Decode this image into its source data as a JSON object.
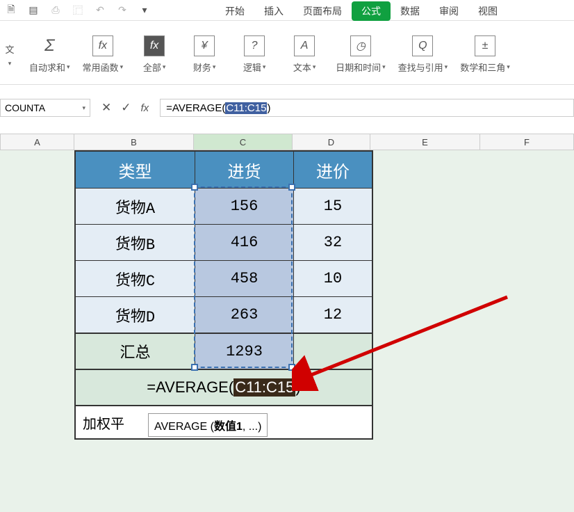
{
  "qab_icons": [
    "save",
    "print",
    "undo",
    "redo",
    "copy",
    "sep",
    "touch"
  ],
  "menu": {
    "start": "开始",
    "insert": "插入",
    "layout": "页面布局",
    "formula": "公式",
    "data": "数据",
    "review": "审阅",
    "view": "视图"
  },
  "ribbon": {
    "sum": {
      "icon": "Σ",
      "label": "自动求和"
    },
    "common": {
      "icon": "fx",
      "label": "常用函数"
    },
    "all": {
      "icon": "fx",
      "label": "全部"
    },
    "finance": {
      "icon": "¥",
      "label": "财务"
    },
    "logic": {
      "icon": "?",
      "label": "逻辑"
    },
    "text": {
      "icon": "A",
      "label": "文本"
    },
    "date": {
      "icon": "◷",
      "label": "日期和时间"
    },
    "lookup": {
      "icon": "Q",
      "label": "查找与引用"
    },
    "math": {
      "icon": "±",
      "label": "数学和三角"
    },
    "sideLabel": "文"
  },
  "namebox": "COUNTA",
  "formula": {
    "pre": "=AVERAGE(",
    "sel": "C11:C15",
    "post": ")"
  },
  "cols": [
    "A",
    "B",
    "C",
    "D",
    "E",
    "F"
  ],
  "table": {
    "hdr": {
      "b": "类型",
      "c": "进货",
      "d": "进价"
    },
    "rows": [
      {
        "b": "货物A",
        "c": "156",
        "d": "15"
      },
      {
        "b": "货物B",
        "c": "416",
        "d": "32"
      },
      {
        "b": "货物C",
        "c": "458",
        "d": "10"
      },
      {
        "b": "货物D",
        "c": "263",
        "d": "12"
      }
    ],
    "total": {
      "b": "汇总",
      "c": "1293",
      "d": ""
    },
    "avg": {
      "pre": "=AVERAGE(",
      "sel": "C11:C15",
      "post": ")"
    },
    "wavg_label": "加权平"
  },
  "tooltip": {
    "fn": "AVERAGE",
    "open": " (",
    "arg": "数值1",
    "rest": ", ...)"
  }
}
